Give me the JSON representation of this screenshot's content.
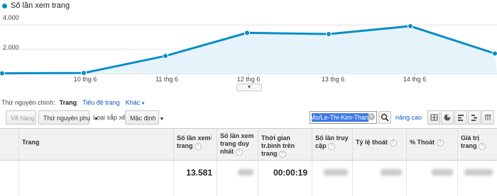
{
  "chart": {
    "legend_label": "Số lần xem trang",
    "series_color": "#058dc7",
    "y_tick_labels": [
      "4.000",
      "2.000"
    ],
    "x_tick_labels": [
      "10 thg 6",
      "11 thg 6",
      "12 thg 6",
      "13 thg 6",
      "14 thg 6"
    ],
    "scroll_handle_icon": "chevron-down-icon"
  },
  "chart_data": {
    "type": "area",
    "x": [
      "9 thg 6",
      "10 thg 6",
      "11 thg 6",
      "12 thg 6",
      "13 thg 6",
      "14 thg 6",
      "15 thg 6"
    ],
    "values": [
      20,
      50,
      1450,
      3350,
      3250,
      3900,
      1650
    ],
    "ylim": [
      0,
      5000
    ],
    "y_ticks": [
      2000,
      4000
    ],
    "grid": true,
    "legend_position": "top-left"
  },
  "dimension_bar": {
    "label": "Thứ nguyên chính:",
    "current": "Trang",
    "page_title_link": "Tiêu đề trang",
    "other_link": "Khác"
  },
  "toolbar": {
    "plot_rows": "Vẽ hàng",
    "secondary_dimension": "Thứ nguyên phụ",
    "sort_type_label": "Loại sắp xếp:",
    "sort_default": "Mặc định",
    "search_value": "ngMo/Le-Thi-Kim-Than",
    "advanced_link": "nâng cao"
  },
  "table": {
    "headers": {
      "page": "Trang",
      "pageviews": "Số lần xem trang",
      "unique_pageviews": "Số lần xem trang duy nhất",
      "avg_time": "Thời gian tr.bình trên trang",
      "entrances": "Số lần truy cập",
      "bounce_rate": "Tỷ lệ thoát",
      "exit_pct": "% Thoát",
      "page_value": "Giá trị trang"
    },
    "totals": {
      "pageviews": "13.581",
      "avg_time": "00:00:19"
    }
  }
}
